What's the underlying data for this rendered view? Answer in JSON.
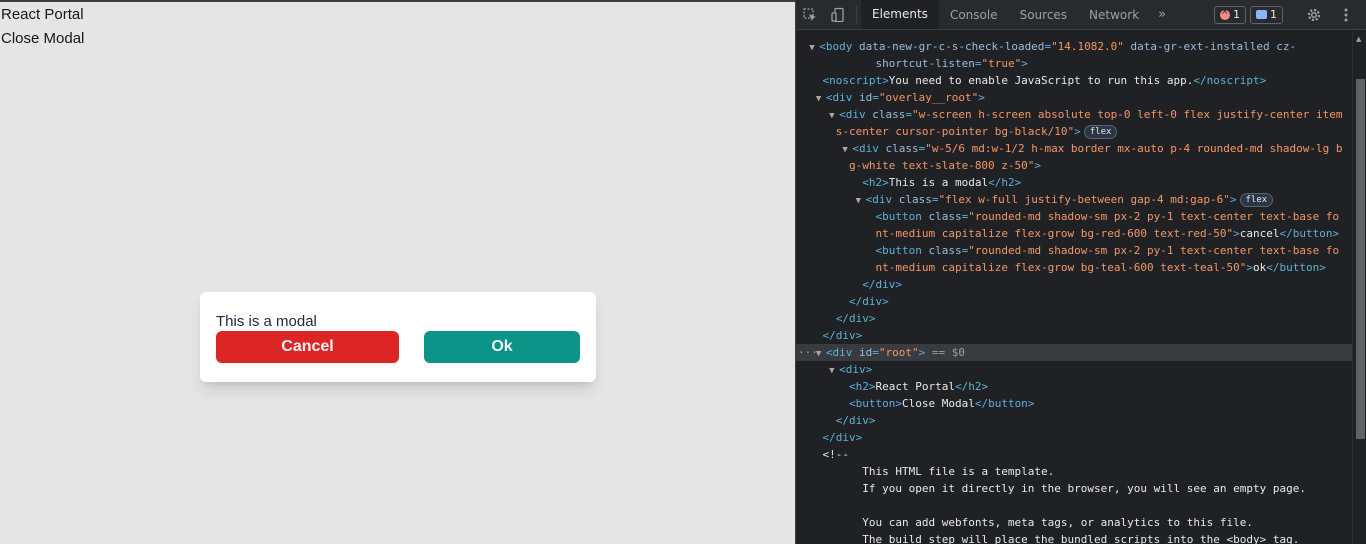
{
  "page": {
    "heading": "React Portal",
    "close_button": "Close Modal",
    "modal": {
      "title": "This is a modal",
      "cancel_label": "Cancel",
      "ok_label": "Ok"
    }
  },
  "devtools": {
    "tabs": [
      "Elements",
      "Console",
      "Sources",
      "Network"
    ],
    "more_tabs": "»",
    "error_count": "1",
    "message_count": "1",
    "icons": [
      "inspect-icon",
      "device-toggle-icon",
      "gear-icon",
      "kebab-menu-icon"
    ],
    "colors": {
      "tag": "#5db0d7",
      "attr": "#9bbbdc",
      "value": "#f29766"
    }
  },
  "dom": {
    "l1_tag": "<body ",
    "l1_a1": "data-new-gr-c-s-check-loaded",
    "l1_v1": "\"14.1082.0\"",
    "l1_a2": "data-gr-ext-installed",
    "l1_a3": "cz-",
    "l2_a3b": "shortcut-listen",
    "l2_v3": "\"true\"",
    "l3_open": "<noscript>",
    "l3_text": "You need to enable JavaScript to run this app.",
    "l3_close": "</noscript>",
    "l4_tag": "<div ",
    "l4_a": "id",
    "l4_v": "\"overlay__root\"",
    "l5_tag": "<div ",
    "l5_a": "class",
    "l5_v": "\"w-screen h-screen absolute top-0 left-0 flex justify-center item",
    "l6_v": "s-center cursor-pointer bg-black/10\"",
    "pill_flex": "flex",
    "l7_a": "class",
    "l7_v": "\"w-5/6 md:w-1/2 h-max border mx-auto p-4 rounded-md shadow-lg b",
    "l8_v": "g-white text-slate-800 z-50\"",
    "l9_open": "<h2>",
    "l9_text": "This is a modal",
    "l9_close": "</h2>",
    "l10_a": "class",
    "l10_v": "\"flex w-full justify-between gap-4 md:gap-6\"",
    "l11_tag": "<button ",
    "l11_a": "class",
    "l11_v": "\"rounded-md shadow-sm px-2 py-1 text-center text-base fo",
    "l12_v": "nt-medium capitalize flex-grow bg-red-600 text-red-50\"",
    "l12_text": "cancel",
    "l12_close": "</button>",
    "l13_v": "\"rounded-md shadow-sm px-2 py-1 text-center text-base fo",
    "l14_v": "nt-medium capitalize flex-grow bg-teal-600 text-teal-50\"",
    "l14_text": "ok",
    "div_close": "</div>",
    "l19_v": "\"root\"",
    "l19_suffix": " == $0",
    "l20_tag": "<div>",
    "l21_text": "React Portal",
    "l22_open": "<button>",
    "l22_text": "Close Modal",
    "l25_cmt": "<!--",
    "l26_cmt": "This HTML file is a template.",
    "l27_cmt": "If you open it directly in the browser, you will see an empty page.",
    "l29_cmt": "You can add webfonts, meta tags, or analytics to this file.",
    "l30_cmt": "The build step will place the bundled scripts into the <body> tag."
  }
}
